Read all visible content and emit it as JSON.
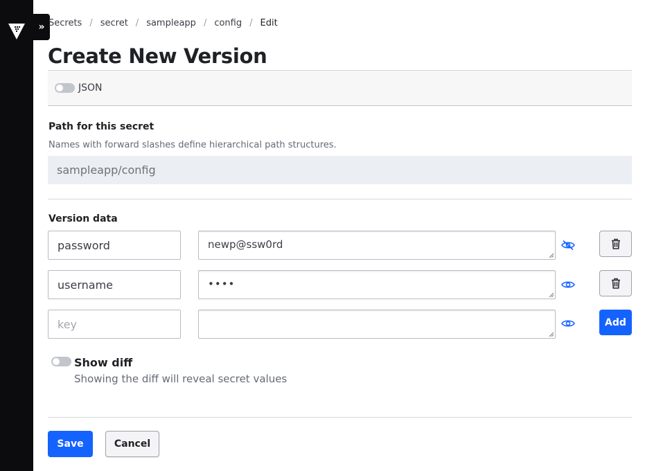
{
  "sidebar": {
    "logo_icon": "vault-logo-icon",
    "expand_label": "»"
  },
  "breadcrumb": {
    "items": [
      "Secrets",
      "secret",
      "sampleapp",
      "config"
    ],
    "current": "Edit",
    "separator": "/"
  },
  "page": {
    "title": "Create New Version"
  },
  "json_toggle": {
    "label": "JSON",
    "enabled": false
  },
  "path": {
    "label": "Path for this secret",
    "help": "Names with forward slashes define hierarchical path structures.",
    "value": "sampleapp/config"
  },
  "version_data": {
    "label": "Version data",
    "rows": [
      {
        "key": "password",
        "value": "newp@ssw0rd",
        "masked": false,
        "eye_icon": "eye-slash-icon",
        "action_icon": "trash-icon"
      },
      {
        "key": "username",
        "value": "••••",
        "masked": true,
        "eye_icon": "eye-icon",
        "action_icon": "trash-icon"
      },
      {
        "key": "",
        "key_placeholder": "key",
        "value": "",
        "masked": true,
        "eye_icon": "eye-icon",
        "action_label": "Add"
      }
    ]
  },
  "show_diff": {
    "label": "Show diff",
    "help": "Showing the diff will reveal secret values",
    "enabled": false
  },
  "actions": {
    "save_label": "Save",
    "cancel_label": "Cancel"
  },
  "colors": {
    "primary": "#1563ff",
    "sidebar": "#0c0c0e"
  }
}
